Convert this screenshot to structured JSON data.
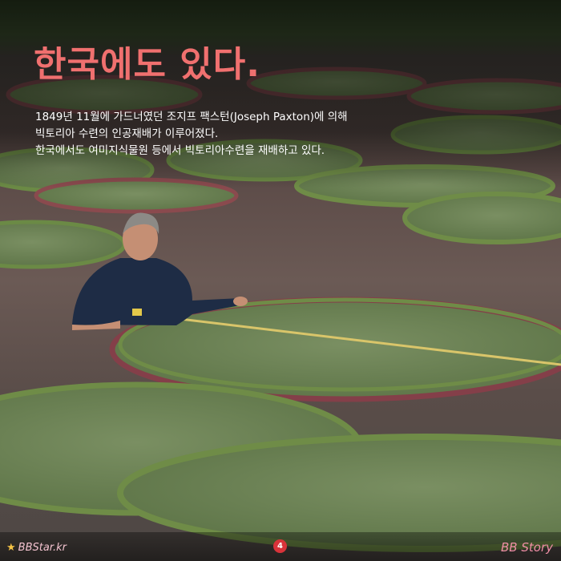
{
  "card": {
    "headline": "한국에도 있다.",
    "body_lines": [
      "1849년 11월에 가드너였던 조지프 팩스턴(Joseph Paxton)에 의해",
      "빅토리아 수련의 인공재배가 이루어졌다.",
      "한국에서도 여미지식물원 등에서 빅토리아수련을 재배하고 있다."
    ]
  },
  "footer": {
    "brand_left_icon": "star-icon",
    "brand_left": "BBStar.kr",
    "page_number": "4",
    "brand_right": "BB Story"
  },
  "colors": {
    "headline": "#f0706f",
    "page_badge": "#d8333a",
    "brand_right": "#f08ea6"
  }
}
